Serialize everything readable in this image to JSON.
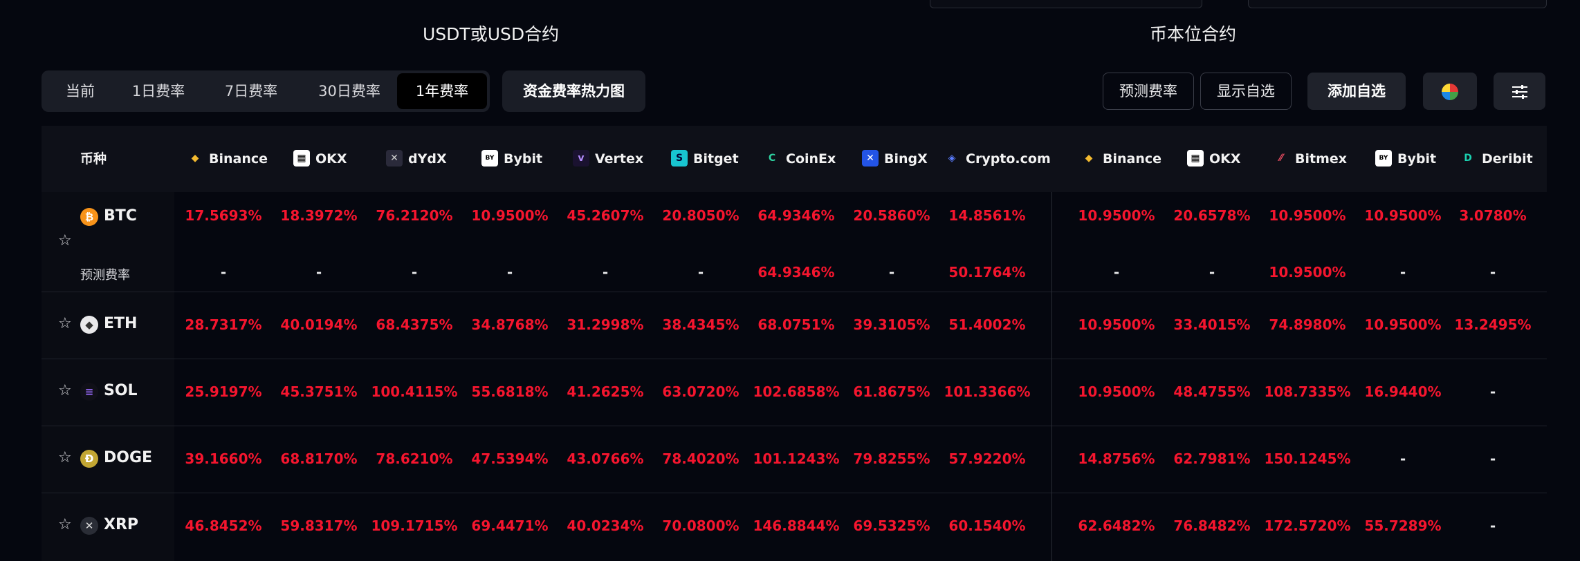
{
  "sections": {
    "usdt_title": "USDT或USD合约",
    "coin_title": "币本位合约"
  },
  "tabs": [
    {
      "label": "当前",
      "active": false
    },
    {
      "label": "1日费率",
      "active": false
    },
    {
      "label": "7日费率",
      "active": false
    },
    {
      "label": "30日费率",
      "active": false
    },
    {
      "label": "1年费率",
      "active": true
    }
  ],
  "toolbar": {
    "heatmap": "资金费率热力图",
    "predicted": "预测费率",
    "show_watchlist": "显示自选",
    "add_watchlist": "添加自选"
  },
  "header": {
    "coin_label": "币种",
    "usdt_exchanges": [
      "Binance",
      "OKX",
      "dYdX",
      "Bybit",
      "Vertex",
      "Bitget",
      "CoinEx",
      "BingX",
      "Crypto.com"
    ],
    "coin_exchanges": [
      "Binance",
      "OKX",
      "Bitmex",
      "Bybit",
      "Deribit"
    ]
  },
  "predicted_label": "预测费率",
  "colors": {
    "negative_red": "#f5152e",
    "background": "#05070f",
    "panel": "#1a1d26"
  },
  "rows": [
    {
      "coin": "BTC",
      "icon": "bitcoin-icon",
      "usdt": [
        "17.5693%",
        "18.3972%",
        "76.2120%",
        "10.9500%",
        "45.2607%",
        "20.8050%",
        "64.9346%",
        "20.5860%",
        "14.8561%"
      ],
      "coin_m": [
        "10.9500%",
        "20.6578%",
        "10.9500%",
        "10.9500%",
        "3.0780%"
      ],
      "pred_usdt": [
        "-",
        "-",
        "-",
        "-",
        "-",
        "-",
        "64.9346%",
        "-",
        "50.1764%"
      ],
      "pred_coin": [
        "-",
        "-",
        "10.9500%",
        "-",
        "-"
      ]
    },
    {
      "coin": "ETH",
      "icon": "ethereum-icon",
      "usdt": [
        "28.7317%",
        "40.0194%",
        "68.4375%",
        "34.8768%",
        "31.2998%",
        "38.4345%",
        "68.0751%",
        "39.3105%",
        "51.4002%"
      ],
      "coin_m": [
        "10.9500%",
        "33.4015%",
        "74.8980%",
        "10.9500%",
        "13.2495%"
      ]
    },
    {
      "coin": "SOL",
      "icon": "solana-icon",
      "usdt": [
        "25.9197%",
        "45.3751%",
        "100.4115%",
        "55.6818%",
        "41.2625%",
        "63.0720%",
        "102.6858%",
        "61.8675%",
        "101.3366%"
      ],
      "coin_m": [
        "10.9500%",
        "48.4755%",
        "108.7335%",
        "16.9440%",
        "-"
      ]
    },
    {
      "coin": "DOGE",
      "icon": "dogecoin-icon",
      "usdt": [
        "39.1660%",
        "68.8170%",
        "78.6210%",
        "47.5394%",
        "43.0766%",
        "78.4020%",
        "101.1243%",
        "79.8255%",
        "57.9220%"
      ],
      "coin_m": [
        "14.8756%",
        "62.7981%",
        "150.1245%",
        "-",
        "-"
      ]
    },
    {
      "coin": "XRP",
      "icon": "xrp-icon",
      "usdt": [
        "46.8452%",
        "59.8317%",
        "109.1715%",
        "69.4471%",
        "40.0234%",
        "70.0800%",
        "146.8844%",
        "69.5325%",
        "60.1540%"
      ],
      "coin_m": [
        "62.6482%",
        "76.8482%",
        "172.5720%",
        "55.7289%",
        "-"
      ]
    }
  ]
}
